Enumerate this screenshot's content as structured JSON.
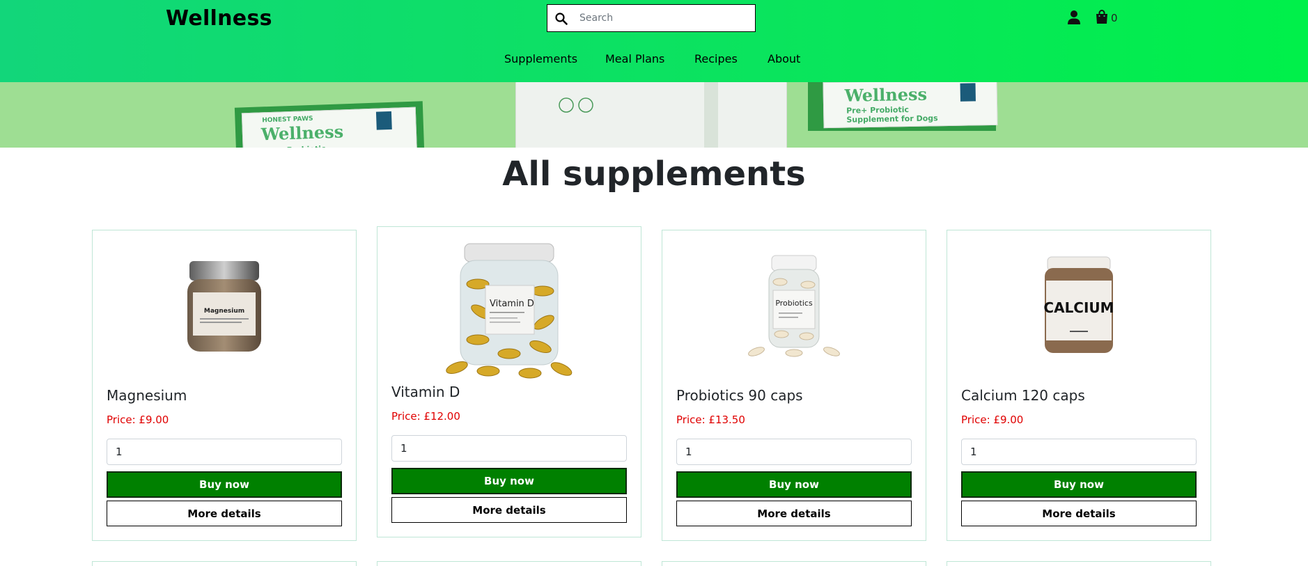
{
  "header": {
    "brand": "Wellness",
    "search_placeholder": "Search",
    "cart_count": "0",
    "nav": [
      "Supplements",
      "Meal Plans",
      "Recipes",
      "About"
    ]
  },
  "banner": {
    "pkg_brand": "Wellness",
    "pkg_maker": "HONEST PAWS",
    "pkg_line1": "Pre+ Probiotic",
    "pkg_line2": "Supplement for Dogs"
  },
  "main": {
    "title": "All supplements",
    "products": [
      {
        "name": "Magnesium",
        "price": "Price: £9.00",
        "qty": "1",
        "buy": "Buy now",
        "more": "More details",
        "label": "Magnesium"
      },
      {
        "name": "Vitamin D",
        "price": "Price: £12.00",
        "qty": "1",
        "buy": "Buy now",
        "more": "More details",
        "label": "Vitamin D"
      },
      {
        "name": "Probiotics 90 caps",
        "price": "Price: £13.50",
        "qty": "1",
        "buy": "Buy now",
        "more": "More details",
        "label": "Probiotics"
      },
      {
        "name": "Calcium 120 caps",
        "price": "Price: £9.00",
        "qty": "1",
        "buy": "Buy now",
        "more": "More details",
        "label": "CALCIUM"
      }
    ]
  },
  "colors": {
    "header_start": "#12d67a",
    "header_end": "#00f04a",
    "buy_button": "#008000",
    "price": "#e00000",
    "card_border": "#bfe6d6"
  }
}
